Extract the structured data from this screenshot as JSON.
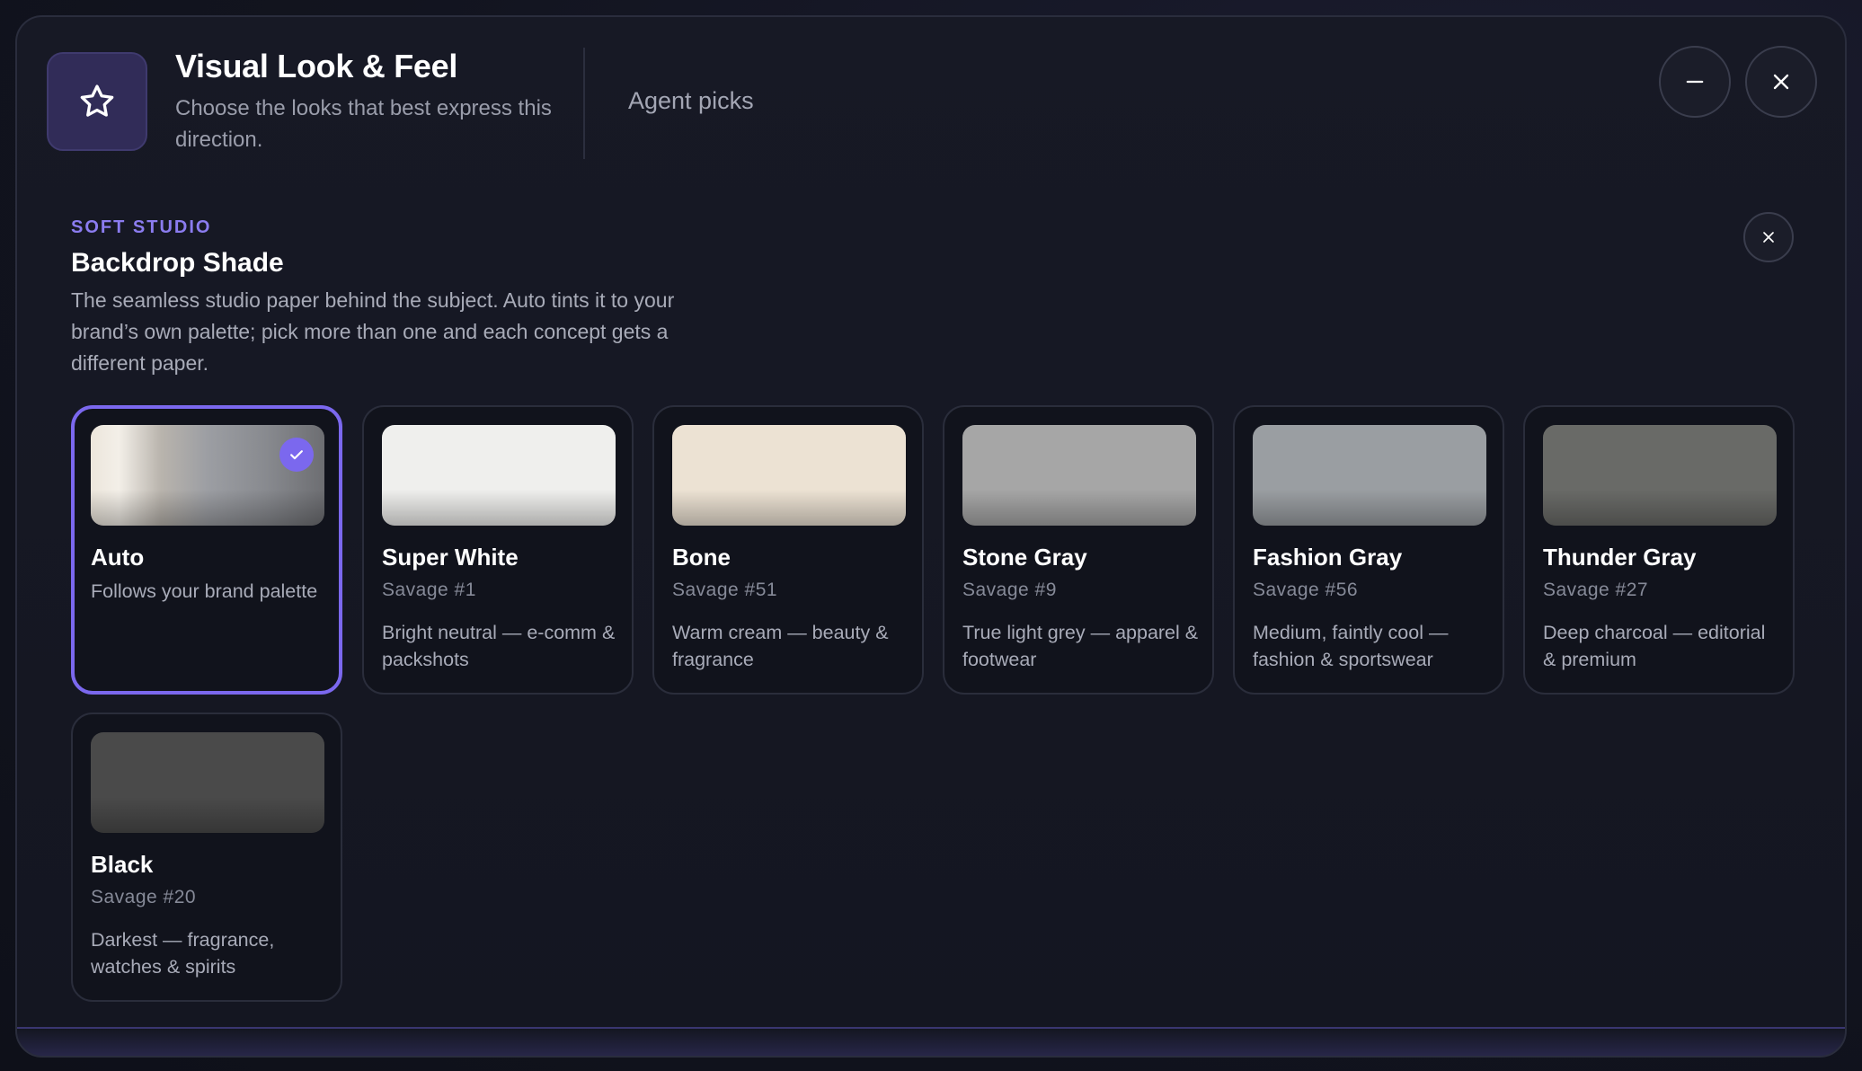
{
  "header": {
    "title": "Visual Look & Feel",
    "subtitle": "Choose the looks that best express this direction.",
    "agent_picks_label": "Agent picks",
    "icon": "star-icon"
  },
  "section": {
    "eyebrow": "SOFT STUDIO",
    "title": "Backdrop Shade",
    "description": "The seamless studio paper behind the subject. Auto tints it to your brand’s own palette; pick more than one and each concept gets a different paper."
  },
  "colors": {
    "accent": "#7b68ee"
  },
  "cards": [
    {
      "name": "Auto",
      "code": "",
      "desc": "Follows your brand palette",
      "selected": true,
      "swatch": "linear-gradient(90deg, #ece6dc 0%, #f3efe8 12%, #b9b4ad 30%, #9c9ea3 50%, #888a8f 75%, #6d6e72 100%)"
    },
    {
      "name": "Super White",
      "code": "Savage #1",
      "desc": "Bright neutral — e-comm & packshots",
      "selected": false,
      "swatch": "#efefed"
    },
    {
      "name": "Bone",
      "code": "Savage #51",
      "desc": "Warm cream — beauty & fragrance",
      "selected": false,
      "swatch": "#ece2d3"
    },
    {
      "name": "Stone Gray",
      "code": "Savage #9",
      "desc": "True light grey — apparel & footwear",
      "selected": false,
      "swatch": "#a6a6a6"
    },
    {
      "name": "Fashion Gray",
      "code": "Savage #56",
      "desc": "Medium, faintly cool — fashion & sportswear",
      "selected": false,
      "swatch": "#9a9ea2"
    },
    {
      "name": "Thunder Gray",
      "code": "Savage #27",
      "desc": "Deep charcoal — editorial & premium",
      "selected": false,
      "swatch": "#696a67"
    },
    {
      "name": "Black",
      "code": "Savage #20",
      "desc": "Darkest — fragrance, watches & spirits",
      "selected": false,
      "swatch": "#4a4a4a"
    }
  ]
}
